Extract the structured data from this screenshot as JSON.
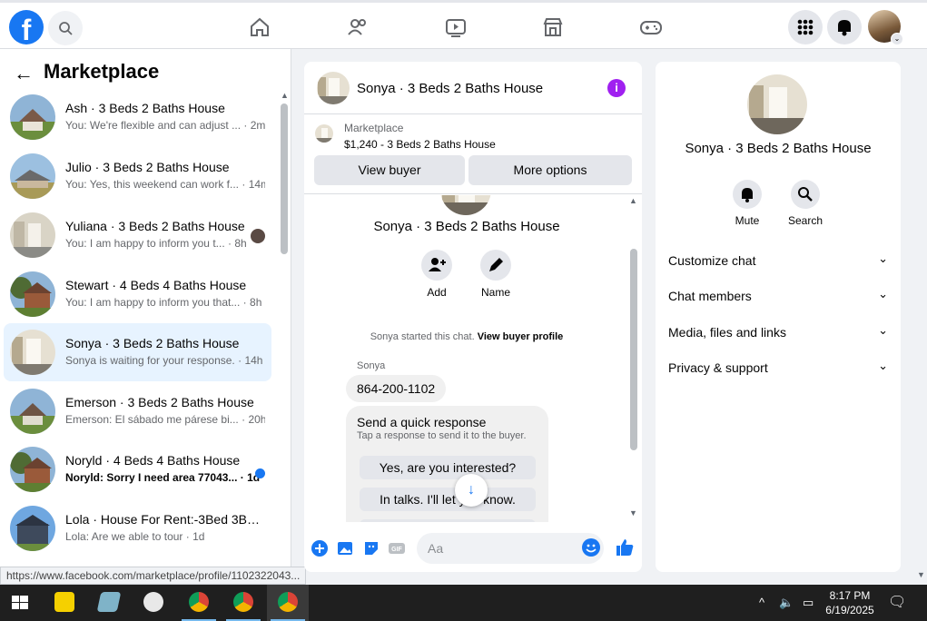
{
  "topbar": {
    "logo": "f",
    "nav_icons": [
      "home-icon",
      "friends-icon",
      "video-icon",
      "marketplace-icon",
      "gaming-icon"
    ],
    "right_icons": [
      "menu-grid-icon",
      "notifications-bell-icon",
      "profile-avatar"
    ]
  },
  "sidebar": {
    "title": "Marketplace",
    "conversations": [
      {
        "name": "Ash · 3 Beds 2 Baths House",
        "preview": "You: We're flexible and can adjust ...",
        "time": "2m",
        "selected": false,
        "unread": false
      },
      {
        "name": "Julio · 3 Beds 2 Baths House",
        "preview": "You: Yes, this weekend can work f...",
        "time": "14m",
        "selected": false,
        "unread": false
      },
      {
        "name": "Yuliana · 3 Beds 2 Baths House",
        "preview": "You: I am happy to inform you t...",
        "time": "8h",
        "selected": false,
        "unread": false
      },
      {
        "name": "Stewart · 4 Beds 4 Baths House",
        "preview": "You: I am happy to inform you that...",
        "time": "8h",
        "selected": false,
        "unread": false
      },
      {
        "name": "Sonya · 3 Beds 2 Baths House",
        "preview": "Sonya is waiting for your response.",
        "time": "14h",
        "selected": true,
        "unread": false
      },
      {
        "name": "Emerson · 3 Beds 2 Baths House",
        "preview": "Emerson: El sábado me párese bi...",
        "time": "20h",
        "selected": false,
        "unread": false
      },
      {
        "name": "Noryld · 4 Beds 4 Baths House",
        "preview": "Noryld: Sorry I need area 77043...",
        "time": "1d",
        "selected": false,
        "unread": true
      },
      {
        "name": "Lola · House For Rent:-3Bed 3Ba...",
        "preview": "Lola: Are we able to tour",
        "time": "1d",
        "selected": false,
        "unread": false
      }
    ],
    "status_url": "https://www.facebook.com/marketplace/profile/1102322043..."
  },
  "chat": {
    "header_title": "Sonya · 3 Beds 2 Baths House",
    "listing_kind": "Marketplace",
    "listing_price": "$1,240 - 3 Beds 2 Baths House",
    "view_buyer_label": "View buyer",
    "more_options_label": "More options",
    "profile_name": "Sonya · 3 Beds 2 Baths House",
    "add_label": "Add",
    "name_label": "Name",
    "system_text": "Sonya started this chat.",
    "system_link": "View buyer profile",
    "sender": "Sonya",
    "message": "864-200-1102",
    "quick_title": "Send a quick response",
    "quick_sub": "Tap a response to send it to the buyer.",
    "quick_options": [
      "Yes, are you interested?",
      "In talks. I'll let you know."
    ],
    "input_placeholder": "Aa"
  },
  "info": {
    "name": "Sonya · 3 Beds 2 Baths House",
    "mute_label": "Mute",
    "search_label": "Search",
    "sections": [
      "Customize chat",
      "Chat members",
      "Media, files and links",
      "Privacy & support"
    ]
  },
  "taskbar": {
    "time": "8:17 PM",
    "date": "6/19/2025"
  },
  "colors": {
    "accent": "#1877f2",
    "selected_bg": "#e7f3ff",
    "info_purple": "#a020f0"
  }
}
